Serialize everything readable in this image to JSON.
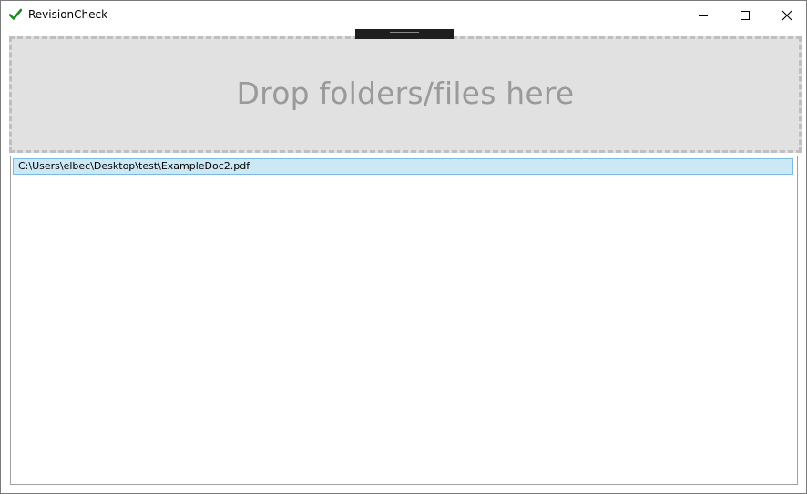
{
  "window": {
    "title": "RevisionCheck",
    "app_icon": "checkmark-icon",
    "accent_color": "#1a8a1a"
  },
  "caption_buttons": {
    "minimize": "minimize-icon",
    "maximize": "maximize-icon",
    "close": "close-icon"
  },
  "dropzone": {
    "label": "Drop folders/files here"
  },
  "filelist": {
    "items": [
      {
        "path": "C:\\Users\\elbec\\Desktop\\test\\ExampleDoc2.pdf",
        "selected": true
      }
    ]
  }
}
